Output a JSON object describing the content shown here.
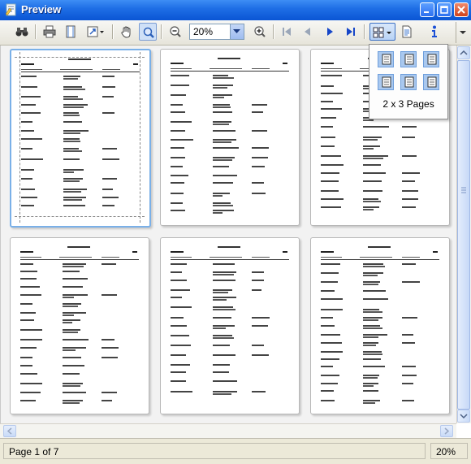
{
  "window": {
    "title": "Preview"
  },
  "toolbar": {
    "zoom_value": "20%",
    "buttons": [
      "find",
      "print",
      "page-setup",
      "scale",
      "hand-tool",
      "zoom-tool",
      "zoom-out",
      "zoom-in",
      "first-page",
      "previous-page",
      "next-page",
      "last-page",
      "multipage",
      "export",
      "info"
    ]
  },
  "layout_popup": {
    "caption": "2 x 3 Pages",
    "options": [
      "1x1",
      "1x2",
      "1x3",
      "2x1",
      "2x2",
      "2x3"
    ]
  },
  "status": {
    "page_text": "Page 1 of 7",
    "zoom_text": "20%"
  },
  "colors": {
    "titlebar": "#0a55d4",
    "accent": "#3a6fc4",
    "info": "#1a4fd6"
  }
}
